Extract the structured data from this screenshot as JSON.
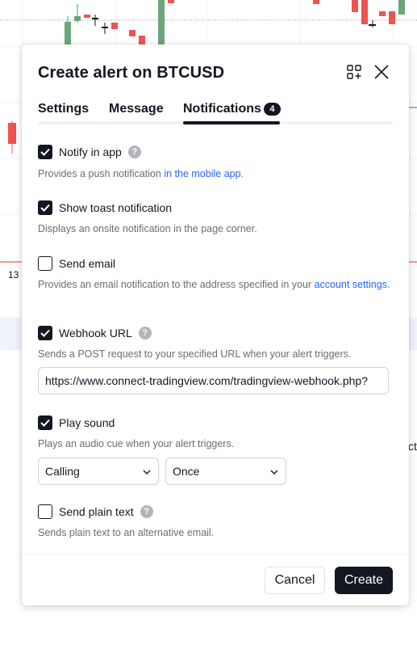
{
  "background": {
    "axis_label": "13",
    "side_label": "ct"
  },
  "dialog": {
    "title": "Create alert on BTCUSD",
    "tabs": [
      {
        "label": "Settings"
      },
      {
        "label": "Message"
      },
      {
        "label": "Notifications",
        "badge": "4",
        "active": true
      }
    ],
    "options": {
      "notify_app": {
        "label": "Notify in app",
        "checked": true,
        "desc_prefix": "Provides a push notification ",
        "desc_link": "in the mobile app",
        "desc_suffix": "."
      },
      "toast": {
        "label": "Show toast notification",
        "checked": true,
        "desc": "Displays an onsite notification in the page corner."
      },
      "email": {
        "label": "Send email",
        "checked": false,
        "desc_prefix": "Provides an email notification to the address specified in your ",
        "desc_link": "account settings",
        "desc_suffix": "."
      },
      "webhook": {
        "label": "Webhook URL",
        "checked": true,
        "desc": "Sends a POST request to your specified URL when your alert triggers.",
        "url_value": "https://www.connect-tradingview.com/tradingview-webhook.php?"
      },
      "sound": {
        "label": "Play sound",
        "checked": true,
        "desc": "Plays an audio cue when your alert triggers.",
        "sound_selected": "Calling",
        "repeat_selected": "Once"
      },
      "plain_text": {
        "label": "Send plain text",
        "checked": false,
        "desc": "Sends plain text to an alternative email."
      }
    },
    "help_glyph": "?",
    "buttons": {
      "cancel": "Cancel",
      "create": "Create"
    }
  },
  "colors": {
    "accent": "#131722",
    "link": "#2962ff",
    "up": "#26a69a",
    "down": "#ef5350"
  }
}
